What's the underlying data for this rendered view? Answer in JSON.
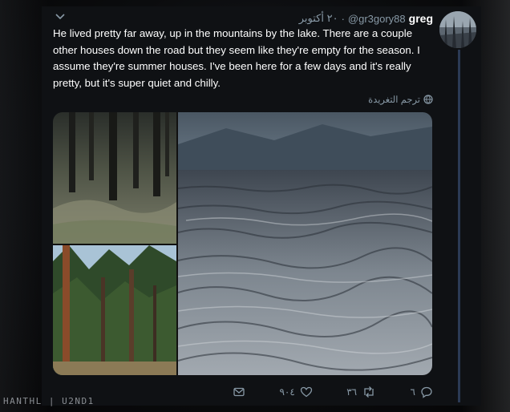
{
  "tweet": {
    "author_name": "greg",
    "handle": "@gr3gory88",
    "separator": "·",
    "date": "٢٠ أكتوبر",
    "text": "He lived pretty far away, up in the mountains by the lake. There are a couple other houses down the road but they seem like they're empty for the season. I assume they're summer houses. I've been here for a few days and it's really pretty, but it's super quiet and chilly.",
    "translate_label": "ترجم التغريدة",
    "media": [
      {
        "icon": "forest-floor-photo"
      },
      {
        "icon": "pine-forest-photo"
      },
      {
        "icon": "lake-mountain-photo"
      }
    ],
    "actions": {
      "reply_count": "٦",
      "retweet_count": "٣٦",
      "like_count": "٩٠٤"
    }
  },
  "watermark": "HANTHL | U2ND1",
  "colors": {
    "background": "#0b0c0e",
    "card": "#0f1114",
    "text": "#ffffff",
    "muted": "#8899a6",
    "thread_line": "#2b3a55"
  }
}
